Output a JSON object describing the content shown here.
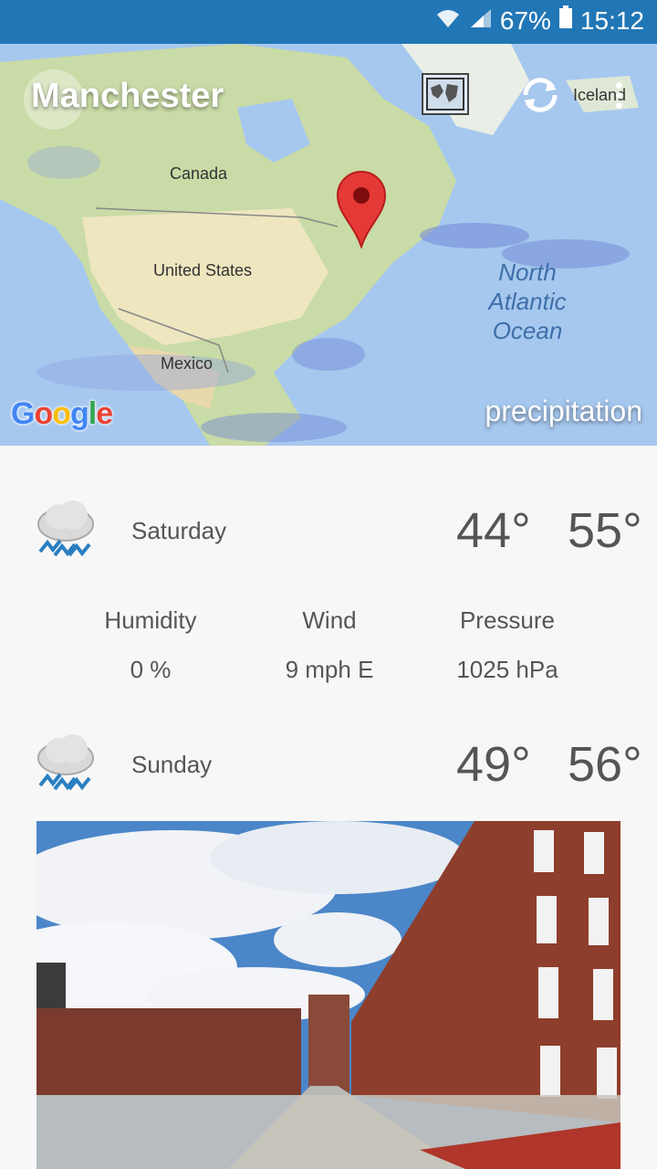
{
  "status_bar": {
    "battery": "67%",
    "time": "15:12"
  },
  "map": {
    "city": "Manchester",
    "labels": {
      "canada": "Canada",
      "usa": "United States",
      "mexico": "Mexico",
      "iceland": "Iceland"
    },
    "ocean": [
      "North",
      "Atlantic",
      "Ocean"
    ],
    "google": "Google",
    "layer_label": "precipitation"
  },
  "forecast": [
    {
      "day": "Saturday",
      "low": "44°",
      "high": "55°",
      "icon": "rain-cloud-icon",
      "details": [
        {
          "label": "Humidity",
          "value": "0 %"
        },
        {
          "label": "Wind",
          "value": "9 mph E"
        },
        {
          "label": "Pressure",
          "value": "1025 hPa"
        }
      ]
    },
    {
      "day": "Sunday",
      "low": "49°",
      "high": "56°",
      "icon": "rain-cloud-icon"
    }
  ]
}
